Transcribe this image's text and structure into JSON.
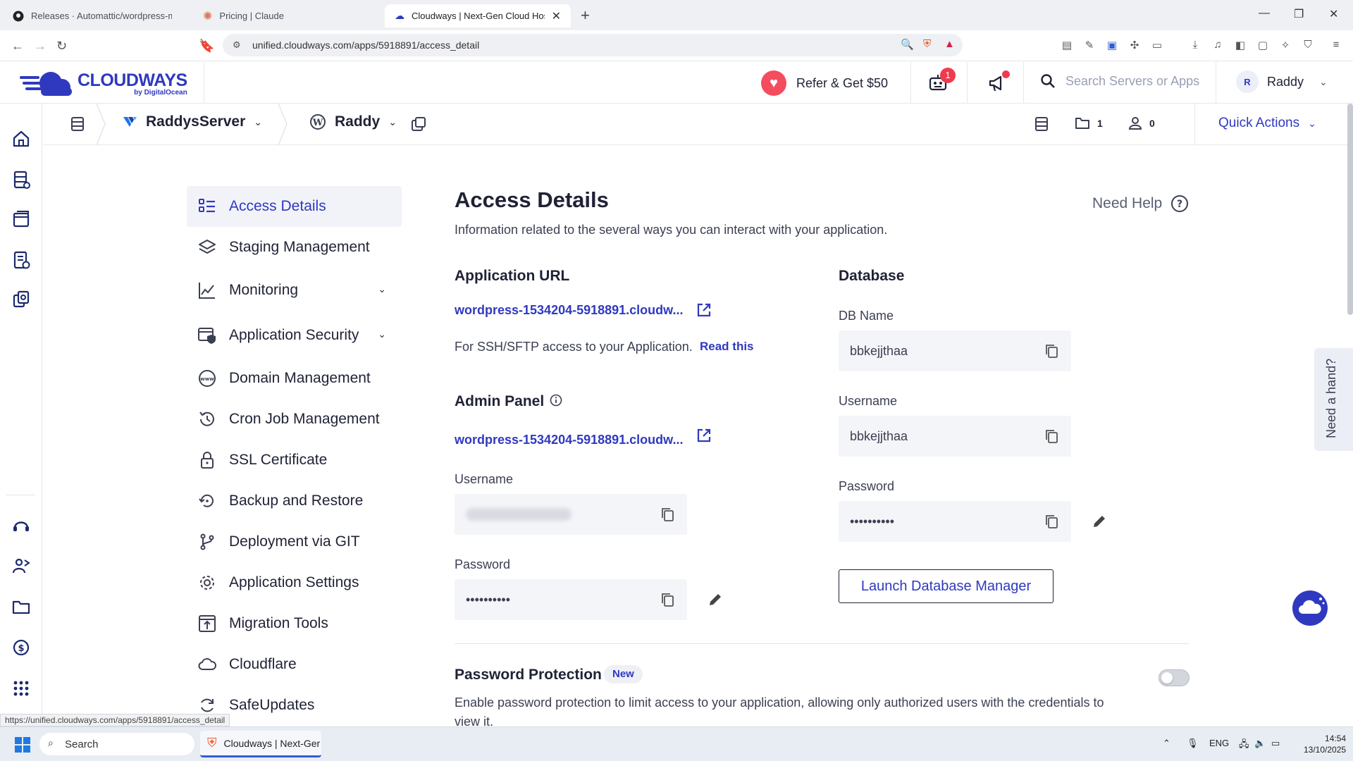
{
  "browser": {
    "tabs": [
      {
        "title": "Releases · Automattic/wordpress-mcp"
      },
      {
        "title": "Pricing | Claude"
      },
      {
        "title": "Cloudways | Next-Gen Cloud Hosting"
      }
    ],
    "url": "unified.cloudways.com/apps/5918891/access_detail",
    "status_url": "https://unified.cloudways.com/apps/5918891/access_detail"
  },
  "header": {
    "brand": "CLOUDWAYS",
    "brand_sub": "by DigitalOcean",
    "refer": "Refer & Get $50",
    "bot_badge": "1",
    "search_placeholder": "Search Servers or Apps",
    "user_initial": "R",
    "user_name": "Raddy"
  },
  "breadcrumb": {
    "server": "RaddysServer",
    "app": "Raddy",
    "folders_count": "1",
    "members_count": "0",
    "quick_actions": "Quick Actions"
  },
  "menu": [
    {
      "label": "Access Details",
      "icon": "access-details-icon"
    },
    {
      "label": "Staging Management",
      "icon": "layers-icon"
    },
    {
      "label": "Monitoring",
      "icon": "chart-line-icon"
    },
    {
      "label": "Application Security",
      "icon": "shield-window-icon"
    },
    {
      "label": "Domain Management",
      "icon": "www-icon"
    },
    {
      "label": "Cron Job Management",
      "icon": "history-icon"
    },
    {
      "label": "SSL Certificate",
      "icon": "lock-icon"
    },
    {
      "label": "Backup and Restore",
      "icon": "restore-icon"
    },
    {
      "label": "Deployment via GIT",
      "icon": "git-branch-icon"
    },
    {
      "label": "Application Settings",
      "icon": "gear-icon"
    },
    {
      "label": "Migration Tools",
      "icon": "upload-window-icon"
    },
    {
      "label": "Cloudflare",
      "icon": "cloud-icon"
    },
    {
      "label": "SafeUpdates",
      "icon": "refresh-icon"
    }
  ],
  "content": {
    "title": "Access Details",
    "lead": "Information related to the several ways you can interact with your application.",
    "need_help": "Need Help",
    "app_url_title": "Application URL",
    "app_url": "wordpress-1534204-5918891.cloudw...",
    "ssh_text": "For SSH/SFTP access to your Application.",
    "read_this": "Read this",
    "admin_title": "Admin Panel",
    "admin_url": "wordpress-1534204-5918891.cloudw...",
    "admin_username_label": "Username",
    "admin_password_label": "Password",
    "admin_password_value": "••••••••••",
    "db_title": "Database",
    "db_name_label": "DB Name",
    "db_name_value": "bbkejjthaa",
    "db_username_label": "Username",
    "db_username_value": "bbkejjthaa",
    "db_password_label": "Password",
    "db_password_value": "••••••••••",
    "launch_db": "Launch Database Manager",
    "pp_title": "Password Protection",
    "pp_badge": "New",
    "pp_desc": "Enable password protection to limit access to your application, allowing only authorized users with the credentials to view it.",
    "need_hand": "Need a hand?"
  },
  "taskbar": {
    "search": "Search",
    "app": "Cloudways | Next-Ger",
    "lang": "ENG",
    "time": "14:54",
    "date": "13/10/2025"
  },
  "colors": {
    "brand": "#2f39bf",
    "heart": "#f44d5e",
    "badge": "#ef3b4e"
  }
}
